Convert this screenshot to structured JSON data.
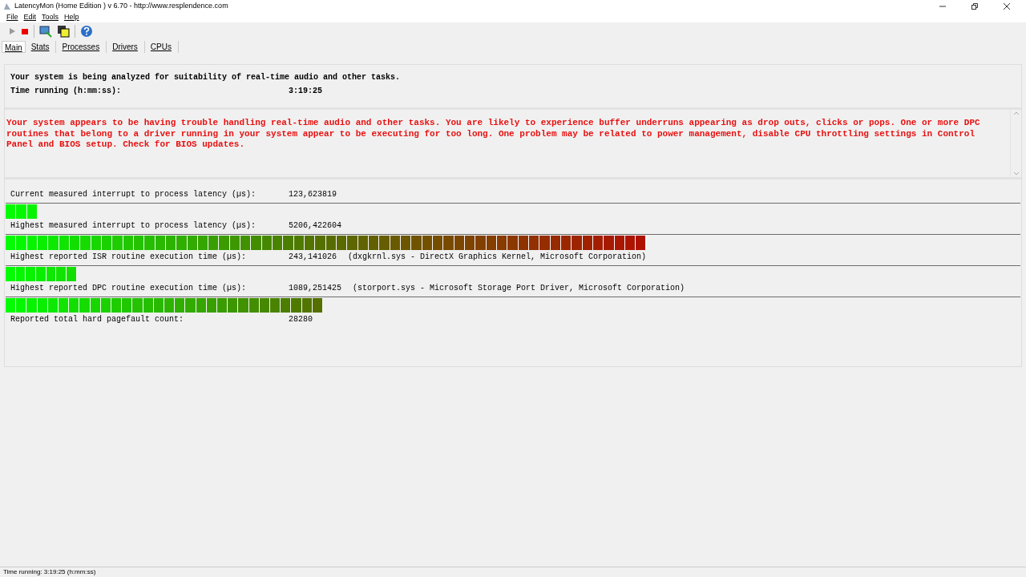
{
  "window": {
    "title": "LatencyMon  (Home Edition )  v 6.70 - http://www.resplendence.com"
  },
  "menu": [
    "File",
    "Edit",
    "Tools",
    "Help"
  ],
  "tabs": [
    {
      "label": "Main",
      "selected": true
    },
    {
      "label": "Stats",
      "selected": false
    },
    {
      "label": "Processes",
      "selected": false
    },
    {
      "label": "Drivers",
      "selected": false
    },
    {
      "label": "CPUs",
      "selected": false
    }
  ],
  "summary": {
    "headline": "Your system is being analyzed for suitability of real-time audio and other tasks.",
    "time_label": "Time running (h:mm:ss):",
    "time_value": "3:19:25"
  },
  "verdict": "Your system appears to be having trouble handling real-time audio and other tasks. You are likely to experience buffer underruns appearing as drop outs, clicks or pops. One or more DPC routines that belong to a driver running in your system appear to be executing for too long. One problem may be related to power management, disable CPU throttling settings in Control Panel and BIOS setup. Check for BIOS updates.",
  "metrics": [
    {
      "label": "Current measured interrupt to process latency (µs):",
      "value": "123,623819",
      "level": 0.032
    },
    {
      "label": "Highest measured interrupt to process latency (µs):",
      "value": "5206,422604",
      "level": 0.632
    },
    {
      "label": "Highest reported ISR routine execution time (µs):",
      "value": "243,141026",
      "detail": "(dxgkrnl.sys - DirectX Graphics Kernel, Microsoft Corporation)",
      "level": 0.07
    },
    {
      "label": "Highest reported DPC routine execution time (µs):",
      "value": "1089,251425",
      "detail": "(storport.sys - Microsoft Storage Port Driver, Microsoft Corporation)",
      "level": 0.313
    },
    {
      "label": "Reported total hard pagefault count:",
      "value": "28280"
    }
  ],
  "status_bar": "Time running: 3:19:25  (h:mm:ss)"
}
